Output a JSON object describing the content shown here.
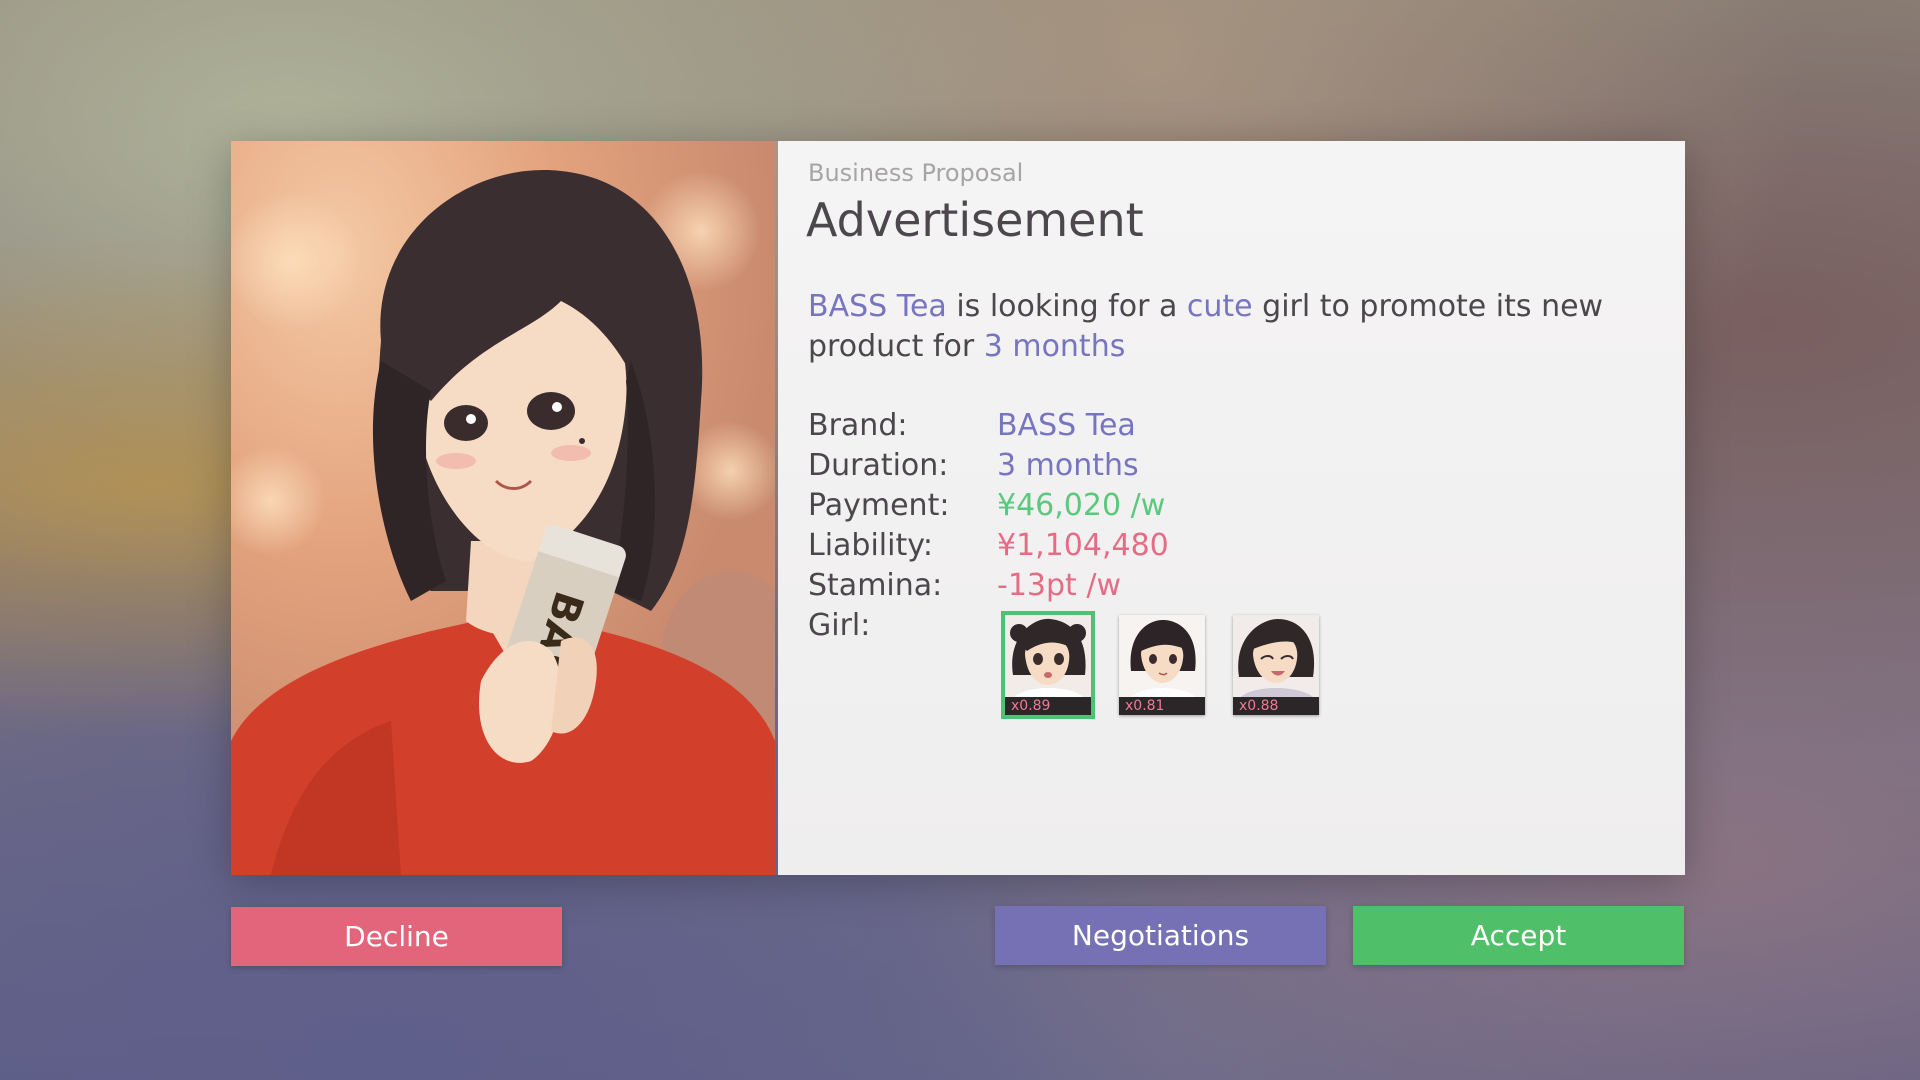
{
  "proposal": {
    "kicker": "Business Proposal",
    "title": "Advertisement",
    "description": {
      "brand": "BASS Tea",
      "part1": " is looking for a ",
      "trait": "cute",
      "part2": " girl to promote its new product for ",
      "duration": "3 months"
    },
    "stats": {
      "brand_label": "Brand:",
      "brand_value": "BASS Tea",
      "duration_label": "Duration:",
      "duration_value": "3 months",
      "payment_label": "Payment:",
      "payment_value": "¥46,020 /w",
      "liability_label": "Liability:",
      "liability_value": "¥1,104,480",
      "stamina_label": "Stamina:",
      "stamina_value": "-13pt /w",
      "girl_label": "Girl:"
    },
    "girls": [
      {
        "multiplier": "x0.89",
        "selected": true
      },
      {
        "multiplier": "x0.81",
        "selected": false
      },
      {
        "multiplier": "x0.88",
        "selected": false
      }
    ]
  },
  "portrait": {
    "can_text": "BASS"
  },
  "buttons": {
    "decline": "Decline",
    "negotiations": "Negotiations",
    "accept": "Accept"
  },
  "colors": {
    "highlight": "#7875c0",
    "payment": "#5bc97c",
    "cost": "#e66c86",
    "decline": "#e3657b",
    "negotiations": "#7571b4",
    "accept": "#4fbf6a"
  }
}
